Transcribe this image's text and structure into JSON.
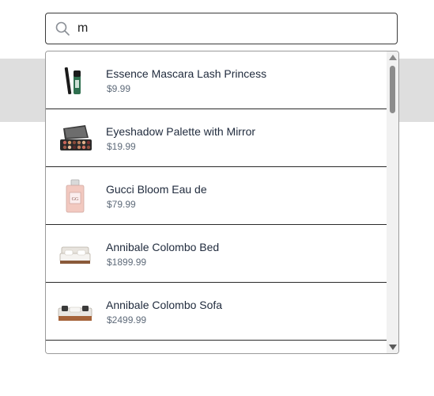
{
  "search": {
    "value": "m",
    "icon": "search-icon"
  },
  "results": [
    {
      "name": "Essence Mascara Lash Princess",
      "price": "$9.99",
      "icon": "mascara-thumbnail"
    },
    {
      "name": "Eyeshadow Palette with Mirror",
      "price": "$19.99",
      "icon": "eyeshadow-palette-thumbnail"
    },
    {
      "name": "Gucci Bloom Eau de",
      "price": "$79.99",
      "icon": "perfume-bottle-thumbnail"
    },
    {
      "name": "Annibale Colombo Bed",
      "price": "$1899.99",
      "icon": "bed-thumbnail"
    },
    {
      "name": "Annibale Colombo Sofa",
      "price": "$2499.99",
      "icon": "sofa-thumbnail"
    }
  ],
  "colors": {
    "band": "#dedede",
    "text": "#1f2a3c",
    "price": "#5f6b7a",
    "border": "#3a3a3a"
  }
}
